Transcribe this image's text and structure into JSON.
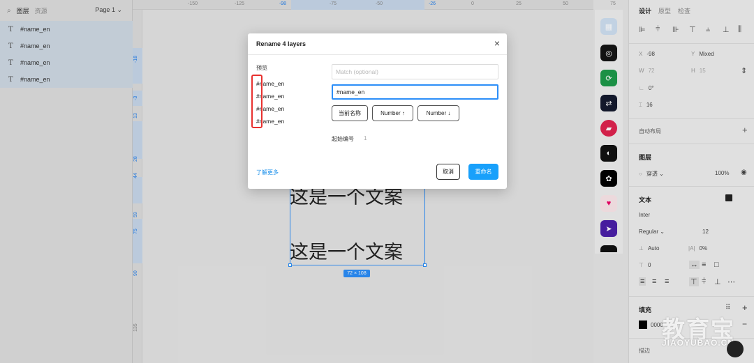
{
  "left_panel": {
    "tabs": [
      "图层",
      "资源"
    ],
    "page_select": "Page 1 ⌄",
    "layers": [
      "#name_en",
      "#name_en",
      "#name_en",
      "#name_en"
    ],
    "text_icon": "T"
  },
  "rulers": {
    "top": [
      "-150",
      "-125",
      "-98",
      "-75",
      "-50",
      "-26",
      "0",
      "25",
      "50",
      "75"
    ],
    "left": [
      "-18",
      "-3",
      "13",
      "28",
      "44",
      "59",
      "75",
      "90",
      "135"
    ]
  },
  "canvas": {
    "text_top": "这是一个文案",
    "text_bottom": "这是一个文案",
    "size_badge": "72 × 108"
  },
  "dialog": {
    "title": "Rename 4 layers",
    "close": "×",
    "preview_label": "预览",
    "preview_items": [
      "#name_en",
      "#name_en",
      "#name_en",
      "#name_en"
    ],
    "match_placeholder": "Match (optional)",
    "name_value": "#name_en",
    "chips": [
      "当前名称",
      "Number ↑",
      "Number ↓"
    ],
    "start_label": "起始编号",
    "start_value": "1",
    "learn_more": "了解更多",
    "cancel": "取消",
    "rename": "重命名"
  },
  "right_panel": {
    "tabs": [
      "设计",
      "原型",
      "检查"
    ],
    "x_label": "X",
    "x_value": "-98",
    "y_label": "Y",
    "y_value": "Mixed",
    "w_label": "W",
    "w_value": "72",
    "h_label": "H",
    "h_value": "15",
    "rotation": "0°",
    "radius": "16",
    "auto_layout": "自动布局",
    "layer_section": "图层",
    "blend": "穿透 ⌄",
    "opacity": "100%",
    "text_section": "文本",
    "font": "Inter",
    "weight": "Regular ⌄",
    "font_size": "12",
    "line_height": "Auto",
    "letter_spacing": "0%",
    "para_spacing": "0",
    "fill_section": "填充",
    "fill_value": "0000",
    "stroke_section": "描边"
  },
  "watermark": {
    "big": "教育宝",
    "small": "JIAOYUBAO.CN"
  },
  "colors": {
    "accent": "#18a0fb",
    "highlight": "#e8312f",
    "selection": "#2c8ef8"
  }
}
